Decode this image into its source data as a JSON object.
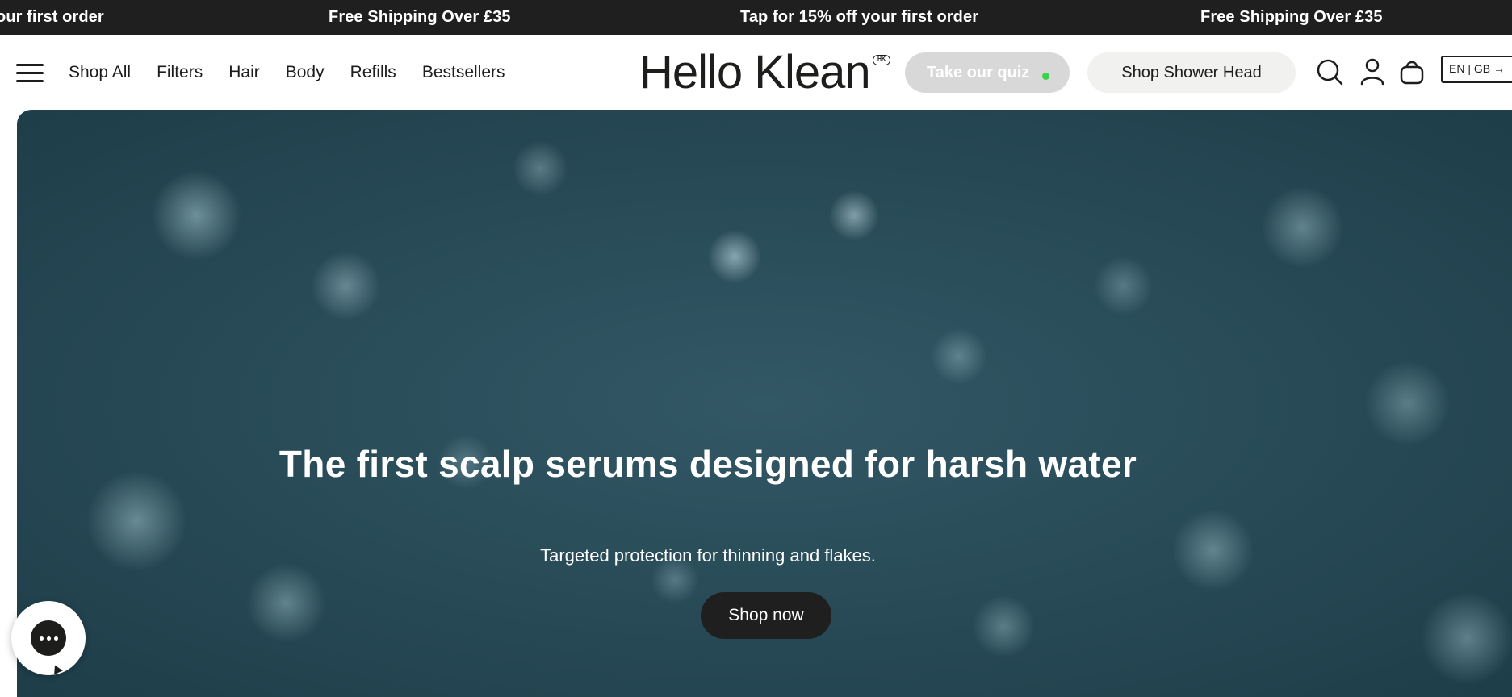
{
  "announcement": {
    "items": [
      "our first order",
      "Free Shipping Over £35",
      "Tap for 15% off your first order",
      "Free Shipping Over £35"
    ]
  },
  "header": {
    "nav": [
      "Shop All",
      "Filters",
      "Hair",
      "Body",
      "Refills",
      "Bestsellers"
    ],
    "logo": "Hello Klean",
    "logo_badge": "HK",
    "quiz_label": "Take our quiz",
    "shower_label": "Shop Shower Head",
    "lang_label": "EN | GB →"
  },
  "hero": {
    "title": "The first scalp serums designed for harsh water",
    "subtitle": "Targeted protection for thinning and flakes.",
    "cta": "Shop now"
  },
  "icons": {
    "menu": "hamburger-icon",
    "search": "search-icon",
    "account": "user-icon",
    "cart": "bag-icon",
    "chat": "chat-icon"
  },
  "colors": {
    "announcement_bg": "#1f1f1f",
    "quiz_bg": "#d8d8d8",
    "quiz_dot": "#39d24a",
    "shower_bg": "#f1f1ef",
    "hero_bg": "#2c4f5c",
    "cta_bg": "#1f1f1f"
  }
}
